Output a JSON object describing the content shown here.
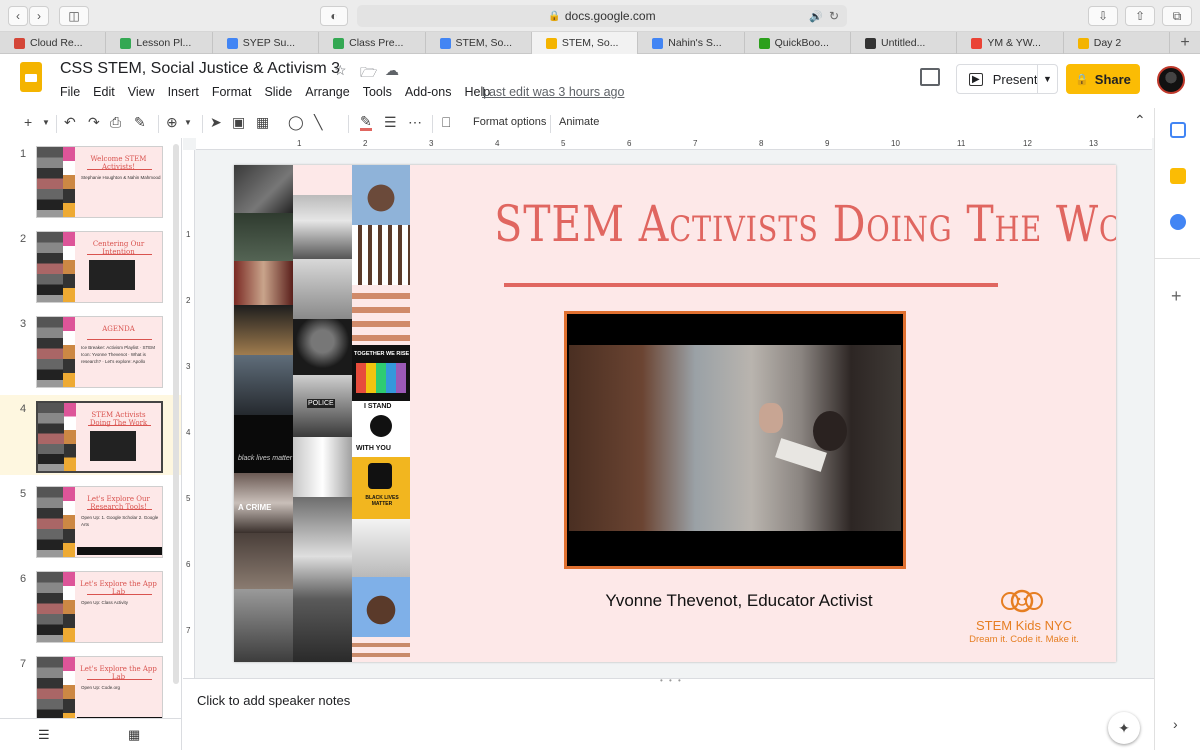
{
  "browser": {
    "url": "docs.google.com",
    "tabs": [
      {
        "label": "Cloud Re...",
        "color": "#d44638"
      },
      {
        "label": "Lesson Pl...",
        "color": "#34a853"
      },
      {
        "label": "SYEP Su...",
        "color": "#4285f4"
      },
      {
        "label": "Class Pre...",
        "color": "#34a853"
      },
      {
        "label": "STEM, So...",
        "color": "#4285f4"
      },
      {
        "label": "STEM, So...",
        "color": "#f4b400"
      },
      {
        "label": "Nahin's S...",
        "color": "#4285f4"
      },
      {
        "label": "QuickBoo...",
        "color": "#2ca01c"
      },
      {
        "label": "Untitled...",
        "color": "#333333"
      },
      {
        "label": "YM & YW...",
        "color": "#ea4335"
      },
      {
        "label": "Day 2",
        "color": "#f4b400"
      }
    ],
    "active_tab_index": 5
  },
  "doc": {
    "title": "CSS STEM, Social Justice & Activism 3",
    "last_edit": "Last edit was 3 hours ago",
    "menu": [
      "File",
      "Edit",
      "View",
      "Insert",
      "Format",
      "Slide",
      "Arrange",
      "Tools",
      "Add-ons",
      "Help"
    ],
    "present_label": "Present",
    "share_label": "Share"
  },
  "toolbar": {
    "format_options": "Format options",
    "animate": "Animate"
  },
  "ruler": {
    "top": [
      "1",
      "2",
      "3",
      "4",
      "5",
      "6",
      "7",
      "8",
      "9",
      "10",
      "11",
      "12",
      "13"
    ],
    "left": [
      "1",
      "2",
      "3",
      "4",
      "5",
      "6",
      "7"
    ]
  },
  "filmstrip": {
    "slides": [
      {
        "num": "1",
        "title": "Welcome STEM Activists!",
        "body": "Stephanie Houghton & Nahin Mahmood"
      },
      {
        "num": "2",
        "title": "Centering Our Intention",
        "body": ""
      },
      {
        "num": "3",
        "title": "AGENDA",
        "body": "Ice Breaker: Activism Playlist · STEM Icon: Yvonne Thevenot · What is research? · Let's explore: Apollo"
      },
      {
        "num": "4",
        "title": "STEM Activists Doing The Work",
        "body": ""
      },
      {
        "num": "5",
        "title": "Let's Explore Our Research Tools!",
        "body": "Open Up: 1. Google Scholar 2. Google Arts"
      },
      {
        "num": "6",
        "title": "Let's Explore the App Lab",
        "body": "Open Up: Class Activity"
      },
      {
        "num": "7",
        "title": "Let's Explore the App Lab",
        "body": "Open Up: Code.org"
      }
    ],
    "selected": "4"
  },
  "slide": {
    "title": "STEM Activists Doing The Work",
    "caption": "Yvonne Thevenot, Educator Activist",
    "logo_name": "STEM Kids NYC",
    "logo_tagline": "Dream it. Code it. Make it.",
    "accent": "#e06660",
    "collage_texts": {
      "black_lives": "BLACK LIVES MATTER",
      "together": "TOGETHER WE RISE",
      "stand": "I STAND",
      "with_you": "WITH YOU",
      "police": "POLICE",
      "black_lives_script": "black lives matter",
      "crime": "A CRIME"
    }
  },
  "notes": {
    "placeholder": "Click to add speaker notes"
  }
}
